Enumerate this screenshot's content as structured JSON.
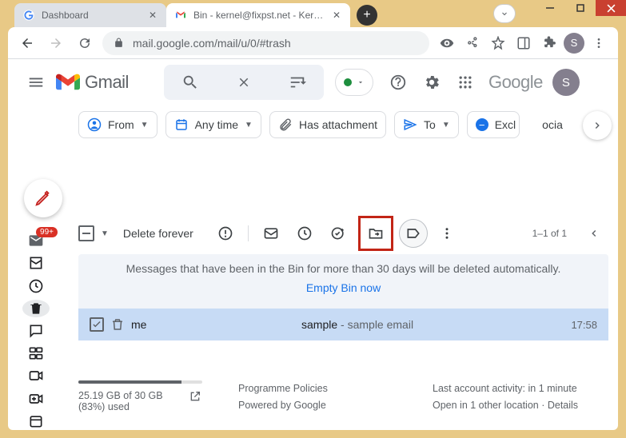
{
  "browser": {
    "tabs": [
      {
        "title": "Dashboard"
      },
      {
        "title": "Bin - kernel@fixpst.net - KernelA"
      }
    ],
    "url_display": "mail.google.com/mail/u/0/#trash",
    "avatar_initial": "S"
  },
  "header": {
    "app_name": "Gmail",
    "google_word": "Google",
    "avatar_initial": "S"
  },
  "chips": {
    "from": "From",
    "any_time": "Any time",
    "has_attachment": "Has attachment",
    "to": "To",
    "exclude": "Excl",
    "social_partial": "ocia"
  },
  "sidebar": {
    "inbox_badge": "99+"
  },
  "toolbar": {
    "delete_forever": "Delete forever",
    "count": "1–1 of 1"
  },
  "banner": {
    "text": "Messages that have been in the Bin for more than 30 days will be deleted automatically.",
    "action": "Empty Bin now"
  },
  "row": {
    "sender": "me",
    "subject": "sample",
    "snippet": " - sample email",
    "time": "17:58"
  },
  "footer": {
    "storage": "25.19 GB of 30 GB (83%) used",
    "policies": "Programme Policies",
    "powered": "Powered by Google",
    "activity": "Last account activity: in 1 minute",
    "location": "Open in 1 other location · Details"
  }
}
